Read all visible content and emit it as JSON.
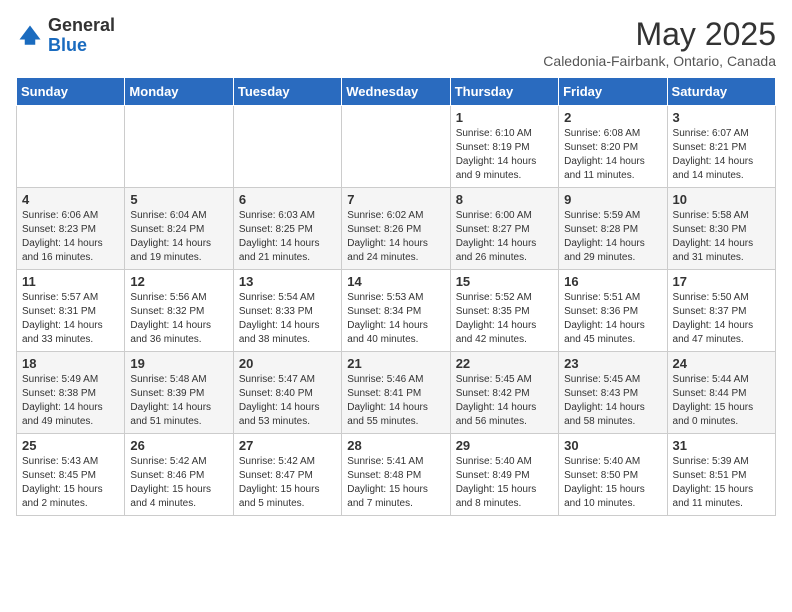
{
  "header": {
    "logo_general": "General",
    "logo_blue": "Blue",
    "title": "May 2025",
    "subtitle": "Caledonia-Fairbank, Ontario, Canada"
  },
  "days_of_week": [
    "Sunday",
    "Monday",
    "Tuesday",
    "Wednesday",
    "Thursday",
    "Friday",
    "Saturday"
  ],
  "weeks": [
    [
      {
        "day": "",
        "info": ""
      },
      {
        "day": "",
        "info": ""
      },
      {
        "day": "",
        "info": ""
      },
      {
        "day": "",
        "info": ""
      },
      {
        "day": "1",
        "info": "Sunrise: 6:10 AM\nSunset: 8:19 PM\nDaylight: 14 hours\nand 9 minutes."
      },
      {
        "day": "2",
        "info": "Sunrise: 6:08 AM\nSunset: 8:20 PM\nDaylight: 14 hours\nand 11 minutes."
      },
      {
        "day": "3",
        "info": "Sunrise: 6:07 AM\nSunset: 8:21 PM\nDaylight: 14 hours\nand 14 minutes."
      }
    ],
    [
      {
        "day": "4",
        "info": "Sunrise: 6:06 AM\nSunset: 8:23 PM\nDaylight: 14 hours\nand 16 minutes."
      },
      {
        "day": "5",
        "info": "Sunrise: 6:04 AM\nSunset: 8:24 PM\nDaylight: 14 hours\nand 19 minutes."
      },
      {
        "day": "6",
        "info": "Sunrise: 6:03 AM\nSunset: 8:25 PM\nDaylight: 14 hours\nand 21 minutes."
      },
      {
        "day": "7",
        "info": "Sunrise: 6:02 AM\nSunset: 8:26 PM\nDaylight: 14 hours\nand 24 minutes."
      },
      {
        "day": "8",
        "info": "Sunrise: 6:00 AM\nSunset: 8:27 PM\nDaylight: 14 hours\nand 26 minutes."
      },
      {
        "day": "9",
        "info": "Sunrise: 5:59 AM\nSunset: 8:28 PM\nDaylight: 14 hours\nand 29 minutes."
      },
      {
        "day": "10",
        "info": "Sunrise: 5:58 AM\nSunset: 8:30 PM\nDaylight: 14 hours\nand 31 minutes."
      }
    ],
    [
      {
        "day": "11",
        "info": "Sunrise: 5:57 AM\nSunset: 8:31 PM\nDaylight: 14 hours\nand 33 minutes."
      },
      {
        "day": "12",
        "info": "Sunrise: 5:56 AM\nSunset: 8:32 PM\nDaylight: 14 hours\nand 36 minutes."
      },
      {
        "day": "13",
        "info": "Sunrise: 5:54 AM\nSunset: 8:33 PM\nDaylight: 14 hours\nand 38 minutes."
      },
      {
        "day": "14",
        "info": "Sunrise: 5:53 AM\nSunset: 8:34 PM\nDaylight: 14 hours\nand 40 minutes."
      },
      {
        "day": "15",
        "info": "Sunrise: 5:52 AM\nSunset: 8:35 PM\nDaylight: 14 hours\nand 42 minutes."
      },
      {
        "day": "16",
        "info": "Sunrise: 5:51 AM\nSunset: 8:36 PM\nDaylight: 14 hours\nand 45 minutes."
      },
      {
        "day": "17",
        "info": "Sunrise: 5:50 AM\nSunset: 8:37 PM\nDaylight: 14 hours\nand 47 minutes."
      }
    ],
    [
      {
        "day": "18",
        "info": "Sunrise: 5:49 AM\nSunset: 8:38 PM\nDaylight: 14 hours\nand 49 minutes."
      },
      {
        "day": "19",
        "info": "Sunrise: 5:48 AM\nSunset: 8:39 PM\nDaylight: 14 hours\nand 51 minutes."
      },
      {
        "day": "20",
        "info": "Sunrise: 5:47 AM\nSunset: 8:40 PM\nDaylight: 14 hours\nand 53 minutes."
      },
      {
        "day": "21",
        "info": "Sunrise: 5:46 AM\nSunset: 8:41 PM\nDaylight: 14 hours\nand 55 minutes."
      },
      {
        "day": "22",
        "info": "Sunrise: 5:45 AM\nSunset: 8:42 PM\nDaylight: 14 hours\nand 56 minutes."
      },
      {
        "day": "23",
        "info": "Sunrise: 5:45 AM\nSunset: 8:43 PM\nDaylight: 14 hours\nand 58 minutes."
      },
      {
        "day": "24",
        "info": "Sunrise: 5:44 AM\nSunset: 8:44 PM\nDaylight: 15 hours\nand 0 minutes."
      }
    ],
    [
      {
        "day": "25",
        "info": "Sunrise: 5:43 AM\nSunset: 8:45 PM\nDaylight: 15 hours\nand 2 minutes."
      },
      {
        "day": "26",
        "info": "Sunrise: 5:42 AM\nSunset: 8:46 PM\nDaylight: 15 hours\nand 4 minutes."
      },
      {
        "day": "27",
        "info": "Sunrise: 5:42 AM\nSunset: 8:47 PM\nDaylight: 15 hours\nand 5 minutes."
      },
      {
        "day": "28",
        "info": "Sunrise: 5:41 AM\nSunset: 8:48 PM\nDaylight: 15 hours\nand 7 minutes."
      },
      {
        "day": "29",
        "info": "Sunrise: 5:40 AM\nSunset: 8:49 PM\nDaylight: 15 hours\nand 8 minutes."
      },
      {
        "day": "30",
        "info": "Sunrise: 5:40 AM\nSunset: 8:50 PM\nDaylight: 15 hours\nand 10 minutes."
      },
      {
        "day": "31",
        "info": "Sunrise: 5:39 AM\nSunset: 8:51 PM\nDaylight: 15 hours\nand 11 minutes."
      }
    ]
  ]
}
